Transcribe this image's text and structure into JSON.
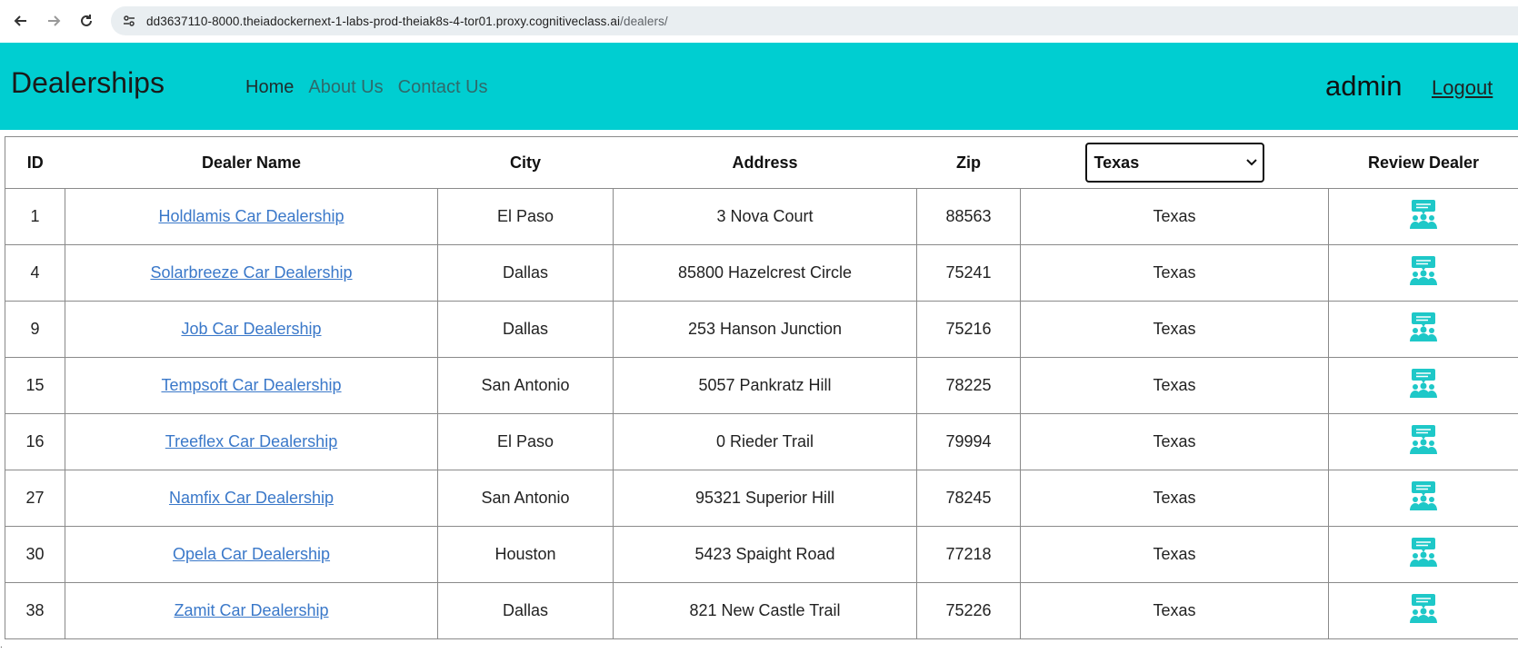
{
  "browser": {
    "url_host": "dd3637110-8000.theiadockernext-1-labs-prod-theiak8s-4-tor01.proxy.cognitiveclass.ai",
    "url_path": "/dealers/"
  },
  "navbar": {
    "brand": "Dealerships",
    "links": [
      "Home",
      "About Us",
      "Contact Us"
    ],
    "user": "admin",
    "logout": "Logout",
    "bg_color": "#00ced1"
  },
  "table": {
    "headers": {
      "id": "ID",
      "name": "Dealer Name",
      "city": "City",
      "address": "Address",
      "zip": "Zip",
      "state_select": "Texas",
      "review": "Review Dealer"
    },
    "rows": [
      {
        "id": "1",
        "name": "Holdlamis Car Dealership",
        "city": "El Paso",
        "address": "3 Nova Court",
        "zip": "88563",
        "state": "Texas"
      },
      {
        "id": "4",
        "name": "Solarbreeze Car Dealership",
        "city": "Dallas",
        "address": "85800 Hazelcrest Circle",
        "zip": "75241",
        "state": "Texas"
      },
      {
        "id": "9",
        "name": "Job Car Dealership",
        "city": "Dallas",
        "address": "253 Hanson Junction",
        "zip": "75216",
        "state": "Texas"
      },
      {
        "id": "15",
        "name": "Tempsoft Car Dealership",
        "city": "San Antonio",
        "address": "5057 Pankratz Hill",
        "zip": "78225",
        "state": "Texas"
      },
      {
        "id": "16",
        "name": "Treeflex Car Dealership",
        "city": "El Paso",
        "address": "0 Rieder Trail",
        "zip": "79994",
        "state": "Texas"
      },
      {
        "id": "27",
        "name": "Namfix Car Dealership",
        "city": "San Antonio",
        "address": "95321 Superior Hill",
        "zip": "78245",
        "state": "Texas"
      },
      {
        "id": "30",
        "name": "Opela Car Dealership",
        "city": "Houston",
        "address": "5423 Spaight Road",
        "zip": "77218",
        "state": "Texas"
      },
      {
        "id": "38",
        "name": "Zamit Car Dealership",
        "city": "Dallas",
        "address": "821 New Castle Trail",
        "zip": "75226",
        "state": "Texas"
      }
    ],
    "link_color": "#3a78c9",
    "review_icon": "review-people-icon",
    "review_icon_color": "#1ec8c8"
  }
}
